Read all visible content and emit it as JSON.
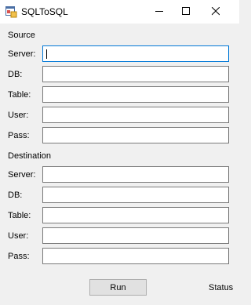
{
  "window": {
    "title": "SQLToSQL",
    "icon": "app-form-icon",
    "controls": [
      "minimize-icon",
      "maximize-icon",
      "close-icon"
    ]
  },
  "source": {
    "heading": "Source",
    "server_label": "Server:",
    "server_value": "",
    "db_label": "DB:",
    "db_value": "",
    "table_label": "Table:",
    "table_value": "",
    "user_label": "User:",
    "user_value": "",
    "pass_label": "Pass:",
    "pass_value": ""
  },
  "destination": {
    "heading": "Destination",
    "server_label": "Server:",
    "server_value": "",
    "db_label": "DB:",
    "db_value": "",
    "table_label": "Table:",
    "table_value": "",
    "user_label": "User:",
    "user_value": "",
    "pass_label": "Pass:",
    "pass_value": ""
  },
  "footer": {
    "run_label": "Run",
    "status_text": "Status"
  },
  "colors": {
    "window_bg": "#f0f0f0",
    "focus_border": "#0078d7",
    "input_border": "#7a7a7a",
    "button_bg": "#e1e1e1"
  }
}
